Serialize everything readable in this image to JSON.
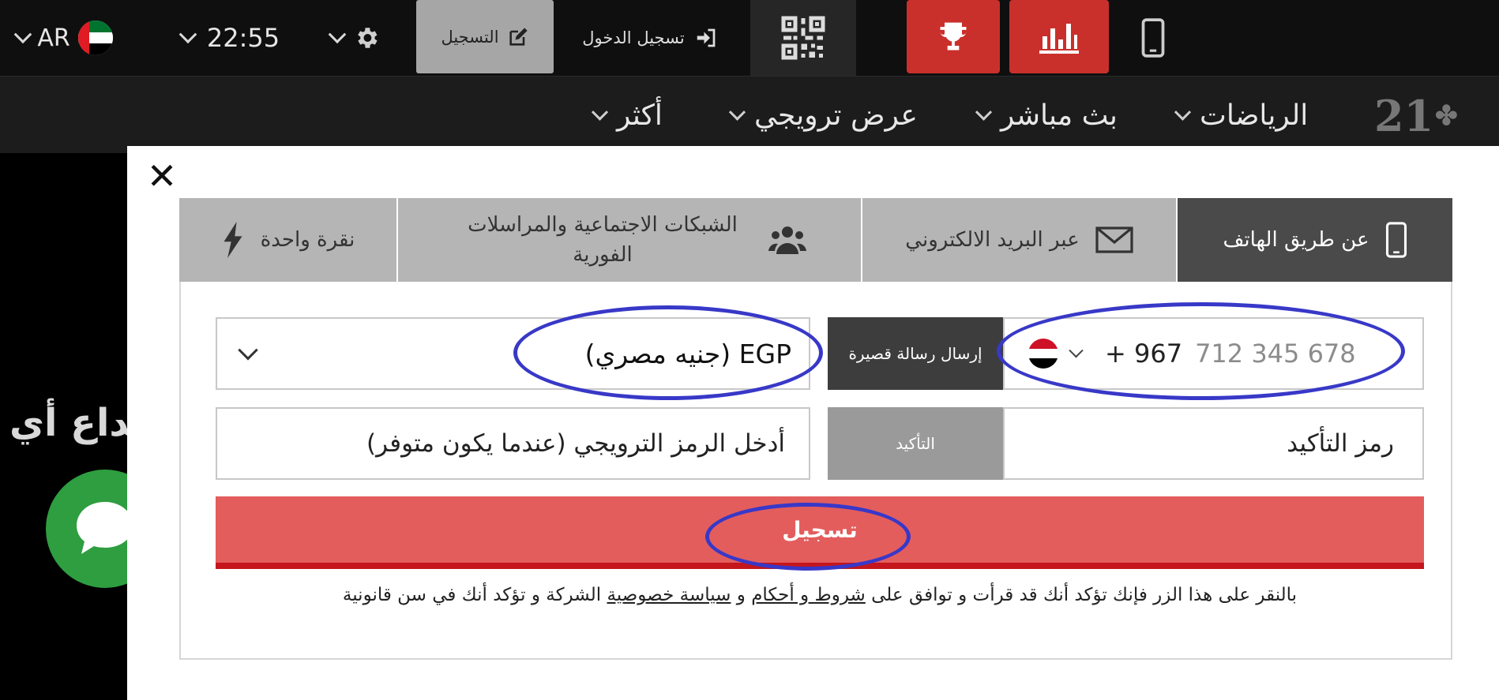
{
  "topbar": {
    "language": "AR",
    "time": "22:55",
    "register_label": "التسجيل",
    "login_label": "تسجيل الدخول"
  },
  "nav": {
    "items": [
      "الرياضات",
      "بث مباشر",
      "عرض ترويجي",
      "أكثر"
    ],
    "logo": "21"
  },
  "background": {
    "partial_text": "إيداع أي"
  },
  "modal": {
    "tabs": [
      {
        "label": "عن طريق الهاتف",
        "icon": "mobile-phone-icon",
        "active": true
      },
      {
        "label": "عبر البريد الالكتروني",
        "icon": "envelope-icon",
        "active": false
      },
      {
        "label": "الشبكات الاجتماعية والمراسلات الفورية",
        "icon": "users-group-icon",
        "active": false
      },
      {
        "label": "نقرة واحدة",
        "icon": "lightning-bolt-icon",
        "active": false
      }
    ],
    "currency": "EGP (جنيه مصري)",
    "sms_button": "إرسال رسالة قصيرة",
    "phone_code": "+ 967",
    "phone_placeholder": "712 345 678",
    "promo_placeholder": "أدخل الرمز الترويجي (عندما يكون متوفر)",
    "confirm_button": "التأكيد",
    "code_placeholder": "رمز التأكيد",
    "submit_label": "تسجيل",
    "terms": {
      "prefix": "بالنقر على هذا الزر فإنك تؤكد أنك قد قرأت و توافق على ",
      "link_terms": "شروط و أحكام",
      "and": " و ",
      "link_privacy": "سياسة خصوصية",
      "suffix": " الشركة و تؤكد أنك في سن قانونية"
    }
  },
  "colors": {
    "accent_red": "#c9302c",
    "submit_red": "#e35d5d",
    "annotation_blue": "#3838c8",
    "chat_green": "#2e9e40"
  }
}
